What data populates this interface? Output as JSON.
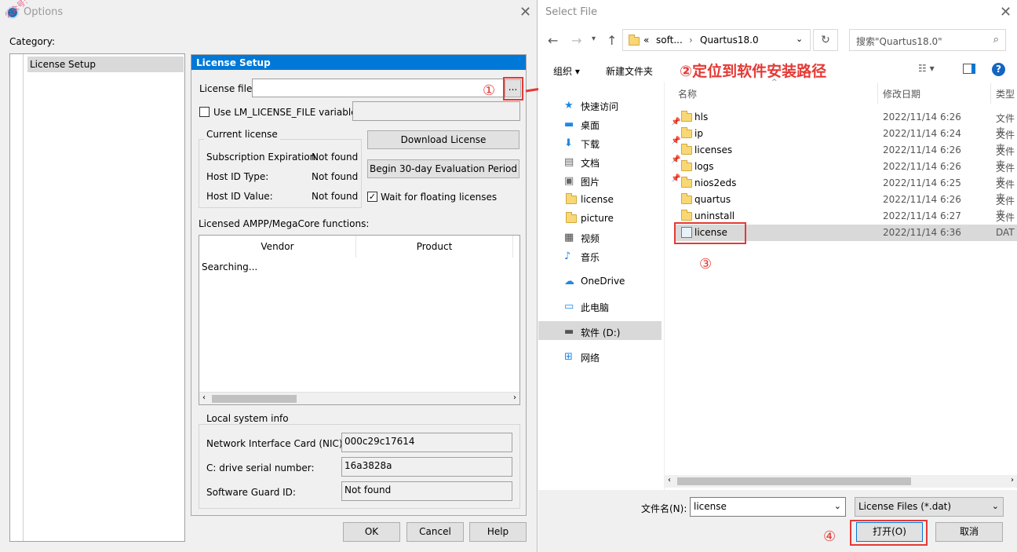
{
  "options": {
    "title": "Options",
    "watermark": "公众号: 软件科技",
    "category_label": "Category:",
    "category_items": [
      "License Setup"
    ],
    "panel_title": "License Setup",
    "license_file_label": "License file:",
    "license_file_value": "",
    "browse_label": "...",
    "lm_var_label": "Use LM_LICENSE_FILE variable:",
    "current_license_title": "Current license",
    "subscription_label": "Subscription Expiration:",
    "subscription_value": "Not found",
    "hostid_type_label": "Host ID Type:",
    "hostid_type_value": "Not found",
    "hostid_value_label": "Host ID Value:",
    "hostid_value_value": "Not found",
    "download_label": "Download License",
    "eval_label": "Begin 30-day Evaluation Period",
    "wait_label": "Wait for floating licenses",
    "wait_checked": "✓",
    "ampp_label": "Licensed AMPP/MegaCore functions:",
    "table_headers": [
      "Vendor",
      "Product"
    ],
    "table_status": "Searching...",
    "local_info_title": "Local system info",
    "nic_label": "Network Interface Card (NIC) ID:",
    "nic_value": "000c29c17614",
    "serial_label": "C: drive serial number:",
    "serial_value": "16a3828a",
    "guard_label": "Software Guard ID:",
    "guard_value": "Not found",
    "ok_label": "OK",
    "cancel_label": "Cancel",
    "help_label": "Help",
    "annot_1": "①"
  },
  "select_file": {
    "title": "Select File",
    "address_prefix": "«",
    "address_parts": [
      "soft...",
      "Quartus18.0"
    ],
    "search_placeholder": "搜索\"Quartus18.0\"",
    "organize_label": "组织 ▾",
    "new_folder_label": "新建文件夹",
    "annot_2": "②定位到软件安装路径",
    "columns": {
      "name": "名称",
      "date": "修改日期",
      "type": "类型"
    },
    "nav_items": [
      {
        "label": "快速访问",
        "icon": "star-icon"
      },
      {
        "label": "桌面",
        "icon": "desktop-icon"
      },
      {
        "label": "下载",
        "icon": "download-icon"
      },
      {
        "label": "文档",
        "icon": "document-icon"
      },
      {
        "label": "图片",
        "icon": "picture-icon"
      },
      {
        "label": "license",
        "icon": "folder-icon"
      },
      {
        "label": "picture",
        "icon": "folder-icon"
      },
      {
        "label": "视频",
        "icon": "video-icon"
      },
      {
        "label": "音乐",
        "icon": "music-icon"
      },
      {
        "label": "OneDrive",
        "icon": "cloud-icon"
      },
      {
        "label": "此电脑",
        "icon": "computer-icon"
      },
      {
        "label": "软件 (D:)",
        "icon": "drive-icon"
      },
      {
        "label": "网络",
        "icon": "network-icon"
      }
    ],
    "files": [
      {
        "name": "hls",
        "date": "2022/11/14 6:26",
        "type": "文件夹"
      },
      {
        "name": "ip",
        "date": "2022/11/14 6:24",
        "type": "文件夹"
      },
      {
        "name": "licenses",
        "date": "2022/11/14 6:26",
        "type": "文件夹"
      },
      {
        "name": "logs",
        "date": "2022/11/14 6:26",
        "type": "文件夹"
      },
      {
        "name": "nios2eds",
        "date": "2022/11/14 6:25",
        "type": "文件夹"
      },
      {
        "name": "quartus",
        "date": "2022/11/14 6:26",
        "type": "文件夹"
      },
      {
        "name": "uninstall",
        "date": "2022/11/14 6:27",
        "type": "文件夹"
      },
      {
        "name": "license",
        "date": "2022/11/14 6:36",
        "type": "DAT"
      }
    ],
    "annot_3": "③",
    "filename_label": "文件名(N):",
    "filename_value": "license",
    "filetype_value": "License Files (*.dat)",
    "open_label": "打开(O)",
    "cancel_label": "取消",
    "annot_4": "④"
  }
}
